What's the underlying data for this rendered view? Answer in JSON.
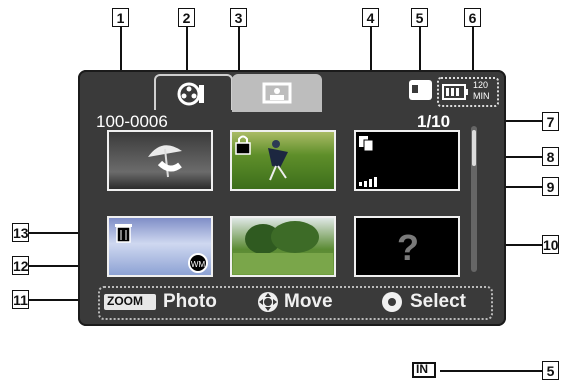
{
  "callouts": [
    "1",
    "2",
    "3",
    "4",
    "5",
    "6",
    "7",
    "8",
    "9",
    "10",
    "11",
    "12",
    "13",
    "5"
  ],
  "screen": {
    "folder_number": "100-0006",
    "page_indicator": "1/10",
    "battery_text": "120",
    "battery_unit": "MIN",
    "tabs": [
      {
        "icon": "movie-film-icon",
        "active": true
      },
      {
        "icon": "photo-icon",
        "active": false
      }
    ],
    "thumbnails": [
      {
        "type": "photo",
        "icon": "umbrella-dancer"
      },
      {
        "type": "photo",
        "icon": "lock-icon"
      },
      {
        "type": "empty",
        "icon": "copy-icon"
      },
      {
        "type": "photo",
        "icon": "trash-icon"
      },
      {
        "type": "photo",
        "icon": "trees-icon"
      },
      {
        "type": "error",
        "icon": "question-icon"
      }
    ],
    "bottom_bar": {
      "zoom_label": "ZOOM",
      "photo_label": "Photo",
      "move_label": "Move",
      "select_label": "Select"
    },
    "in_label": "IN"
  },
  "colors": {
    "screen_bg": "#3a3a3a",
    "accent": "#ffffff"
  }
}
